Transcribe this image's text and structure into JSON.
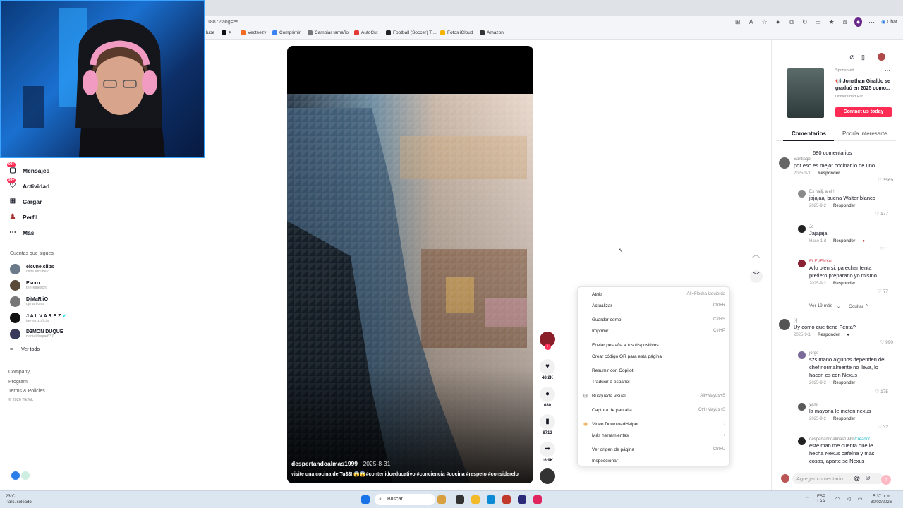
{
  "browser": {
    "url": "1887?lang=es",
    "chat_label": "Chat",
    "bookmarks": [
      {
        "label": "lube",
        "icon": "youtube-icon"
      },
      {
        "label": "X",
        "icon": "x-icon"
      },
      {
        "label": "Vecteezy",
        "icon": "vecteezy-icon"
      },
      {
        "label": "Comprimir",
        "icon": "compress-icon"
      },
      {
        "label": "Cambiar tamaño",
        "icon": "resize-icon"
      },
      {
        "label": "AutoCut",
        "icon": "autocut-icon"
      },
      {
        "label": "Football (Soccer) Ti...",
        "icon": "football-icon"
      },
      {
        "label": "Fotos iCloud",
        "icon": "icloud-icon"
      },
      {
        "label": "Amazon",
        "icon": "amazon-icon"
      }
    ]
  },
  "sidebar": {
    "items": [
      {
        "label": "Mensajes",
        "badge": "99+",
        "icon": "message-icon"
      },
      {
        "label": "Actividad",
        "badge": "99+",
        "icon": "activity-icon"
      },
      {
        "label": "Cargar",
        "icon": "upload-icon"
      },
      {
        "label": "Perfil",
        "icon": "profile-icon"
      },
      {
        "label": "Más",
        "icon": "more-icon"
      }
    ],
    "following_header": "Cuentas que sigues",
    "following": [
      {
        "name": "elc0ne.clips",
        "handle": "clips.elc0ne2"
      },
      {
        "name": "Escro",
        "handle": "therealescro"
      },
      {
        "name": "DjMaRiiO",
        "handle": "djmariiojus"
      },
      {
        "name": "J A L V A R E Z",
        "handle": "juevanzoficial"
      },
      {
        "name": "D3MON DUQUE",
        "handle": "danielduque637"
      }
    ],
    "see_all": "Ver todo",
    "footer": [
      "Company",
      "Program",
      "Terms & Policies",
      "© 2026 TikTok"
    ]
  },
  "video": {
    "author": "despertandoalmas1999",
    "date": " · 2025-8-31",
    "description": "visite una cocina de Tu$$I 😱😱#contenidoeducativo #conciencia #cocina #respeto #considerelo",
    "likes": "48.2K",
    "comments": "680",
    "saves": "8712",
    "shares": "16.9K"
  },
  "context_menu": [
    {
      "label": "Atrás",
      "shortcut": "Alt+Flecha izquierda"
    },
    {
      "label": "Actualizar",
      "shortcut": "Ctrl+R"
    },
    {
      "label": "Guardar como",
      "shortcut": "Ctrl+S"
    },
    {
      "label": "Imprimir",
      "shortcut": "Ctrl+P"
    },
    {
      "label": "Enviar pestaña a tus dispositivos",
      "shortcut": ""
    },
    {
      "label": "Crear código QR para esta página",
      "shortcut": ""
    },
    {
      "label": "Resumir con Copilot",
      "shortcut": ""
    },
    {
      "label": "Traducir a español",
      "shortcut": ""
    },
    {
      "label": "Búsqueda visual",
      "shortcut": "Alt+Mayús+S"
    },
    {
      "label": "Captura de pantalla",
      "shortcut": "Ctrl+Mayús+S"
    },
    {
      "label": "Video DownloadHelper",
      "shortcut": "›"
    },
    {
      "label": "Más herramientas",
      "shortcut": "›"
    },
    {
      "label": "Ver origen de página",
      "shortcut": "Ctrl+U"
    },
    {
      "label": "Inspeccionar",
      "shortcut": ""
    }
  ],
  "ad": {
    "sponsored": "Sponsored",
    "title": "📢 Jonathan Giraldo se graduó en 2025 como...",
    "subtitle": "Universidad Ean",
    "cta": "Contact us today"
  },
  "tabs": {
    "comments": "Comentarios",
    "suggested": "Podría interesarte"
  },
  "comments_count": "680 comentarios",
  "comments": [
    {
      "user": "Santiago",
      "text": "por eso es mejor cocinar lo de uno",
      "date": "2025-9-1",
      "reply": "Responder",
      "likes": "3569"
    },
    {
      "user": "Es najlj, a el !!",
      "text": "jajajaaj buena Walter blanco",
      "date": "2025-9-2",
      "reply": "Responder",
      "likes": "177"
    },
    {
      "user": "Jo",
      "text": "Jajajaja",
      "date": "Hace 1 d",
      "reply": "Responder",
      "likes": "1"
    },
    {
      "user": "ELEVENYAI",
      "text": "A lo bien si, pa echar fenta prefiero prepararlo yo mismo",
      "date": "2025-9-2",
      "reply": "Responder",
      "likes": "77"
    },
    {
      "user": "[•]",
      "text": "Uy como que tiene Fenta?",
      "date": "2025-9-1",
      "reply": "Responder",
      "likes": "990"
    },
    {
      "user": "jorge",
      "text": "szs mano algunos dependen del chef normalmente no lleva, lo hacen es con Nexus",
      "date": "2025-9-2",
      "reply": "Responder",
      "likes": "175"
    },
    {
      "user": "yami",
      "text": "la mayoria le meten nexus",
      "date": "2025-9-2",
      "reply": "Responder",
      "likes": "32"
    },
    {
      "user": "despertandoalmas1999",
      "creator": "Creador",
      "text": "este man me cuenta que le hecha Nexus cafeína y más cosas, aparte se Nexus",
      "date": "",
      "reply": "",
      "likes": ""
    }
  ],
  "more_replies": "Ver 19 más",
  "hide": "Ocultar",
  "add_comment_placeholder": "Agregar comentario...",
  "taskbar": {
    "weather_temp": "23°C",
    "weather_desc": "Parc. soleado",
    "search": "Buscar",
    "lang1": "ESP",
    "lang2": "LAA",
    "time": "5:37 p. m.",
    "date": "30/03/2026"
  }
}
